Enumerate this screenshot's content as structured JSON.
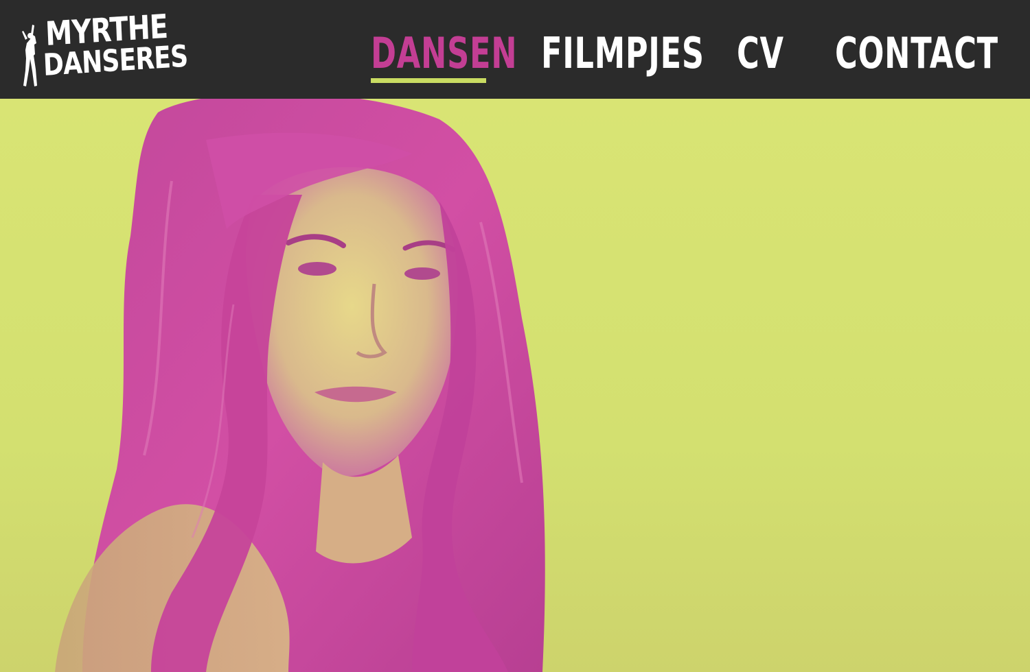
{
  "brand": {
    "logo_line1": "MYRTHE",
    "logo_line2": "DANSERES"
  },
  "nav": {
    "items": [
      {
        "label": "DANSEN",
        "active": true
      },
      {
        "label": "FILMPJES",
        "active": false
      },
      {
        "label": "CV",
        "active": false
      },
      {
        "label": "CONTACT",
        "active": false
      }
    ]
  },
  "colors": {
    "header_bg": "#2b2b2b",
    "accent_pink": "#c33e94",
    "accent_lime": "#c9dc62",
    "hero_bg": "#d7e06e"
  },
  "icons": {
    "logo_figure": "dancer-silhouette-icon"
  }
}
